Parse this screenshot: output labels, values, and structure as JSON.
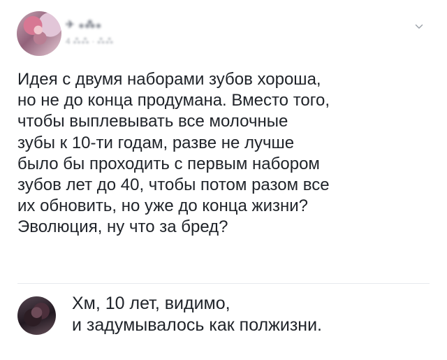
{
  "post": {
    "author_name": "✈ ⁎⁂⁎",
    "meta": "4 ⁂⁂ · ⁂⁂",
    "body": "Идея с двумя наборами зубов хороша,\nно не до конца продумана. Вместо того,\nчтобы выплевывать все молочные\nзубы к 10-ти годам, разве не лучше\nбыло бы проходить с первым набором\nзубов лет до 40, чтобы потом разом все\nих обновить, но уже до конца жизни?\nЭволюция, ну что за бред?"
  },
  "reply": {
    "text": "Хм, 10 лет, видимо,\nи задумывалось как полжизни."
  },
  "icons": {
    "post_menu": "chevron-down-icon"
  }
}
